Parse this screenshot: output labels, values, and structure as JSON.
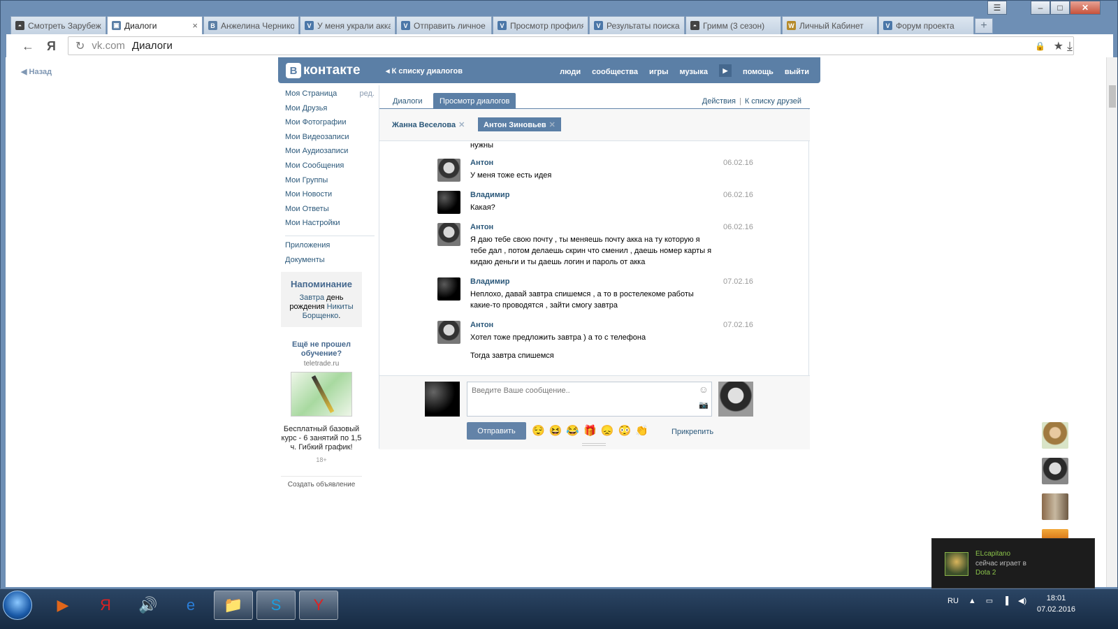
{
  "window": {
    "controls": [
      "☰",
      "–",
      "□",
      "✕"
    ]
  },
  "tabs": [
    {
      "label": "Смотреть Зарубежные",
      "icon": "ghost-icon",
      "color": "#444",
      "glyph": "◓"
    },
    {
      "label": "Диалоги",
      "icon": "vk-icon",
      "color": "#5b7fa6",
      "glyph": "▣",
      "active": true,
      "close": "×"
    },
    {
      "label": "Анжелина Черникова",
      "icon": "vk-icon",
      "color": "#5b7fa6",
      "glyph": "B"
    },
    {
      "label": "У меня украли аккаунт",
      "icon": "forum-icon",
      "color": "#4b77a8",
      "glyph": "V"
    },
    {
      "label": "Отправить личное",
      "icon": "forum-icon",
      "color": "#4b77a8",
      "glyph": "V"
    },
    {
      "label": "Просмотр профиля",
      "icon": "forum-icon",
      "color": "#4b77a8",
      "glyph": "V"
    },
    {
      "label": "Результаты поиска",
      "icon": "forum-icon",
      "color": "#4b77a8",
      "glyph": "V"
    },
    {
      "label": "Гримм (3 сезон)",
      "icon": "ghost-icon",
      "color": "#444",
      "glyph": "◓"
    },
    {
      "label": "Личный Кабинет",
      "icon": "wow-icon",
      "color": "#b58a2a",
      "glyph": "W"
    },
    {
      "label": "Форум проекта",
      "icon": "forum-icon",
      "color": "#4b77a8",
      "glyph": "V"
    }
  ],
  "toolbar": {
    "back": "←",
    "yandex": "Я",
    "reload": "↻",
    "host": "vk.com",
    "title": "Диалоги",
    "lock": "🔒",
    "star": "★",
    "download": "⤓"
  },
  "page": {
    "back_link": "Назад",
    "header": {
      "logo_b": "B",
      "logo_text": "контакте",
      "back_to_list": "К списку диалогов",
      "nav": [
        "люди",
        "сообщества",
        "игры",
        "музыка",
        "помощь",
        "выйти"
      ]
    },
    "left_menu": [
      {
        "label": "Моя Страница",
        "edit": "ред."
      },
      {
        "label": "Мои Друзья"
      },
      {
        "label": "Мои Фотографии"
      },
      {
        "label": "Мои Видеозаписи"
      },
      {
        "label": "Мои Аудиозаписи"
      },
      {
        "label": "Мои Сообщения"
      },
      {
        "label": "Мои Группы"
      },
      {
        "label": "Мои Новости"
      },
      {
        "label": "Мои Ответы"
      },
      {
        "label": "Мои Настройки"
      }
    ],
    "left_menu_extra": [
      "Приложения",
      "Документы"
    ],
    "reminder": {
      "title": "Напоминание",
      "w1": "Завтра",
      "w2": "день рождения",
      "w3": "Никиты Борщенко",
      "w4": "."
    },
    "ad": {
      "title": "Ещё не прошел обучение?",
      "domain": "teletrade.ru",
      "desc": "Бесплатный базовый курс - 6 занятий по 1,5 ч. Гибкий график!",
      "age": "18+",
      "create": "Создать объявление"
    },
    "subtabs": {
      "dialogs": "Диалоги",
      "view": "Просмотр диалогов",
      "actions": "Действия",
      "sep": "|",
      "friends": "К списку друзей"
    },
    "peers": [
      {
        "name": "Жанна Веселова",
        "x": "✕"
      },
      {
        "name": "Антон Зиновьев",
        "x": "✕",
        "active": true
      }
    ],
    "partial_text": "нужны",
    "messages": [
      {
        "author": "Антон",
        "date": "06.02.16",
        "text": "У меня тоже есть идея",
        "who": "anton"
      },
      {
        "author": "Владимир",
        "date": "06.02.16",
        "text": "Какая?",
        "who": "vlad"
      },
      {
        "author": "Антон",
        "date": "06.02.16",
        "text": "Я даю тебе свою почту , ты меняешь почту акка на ту которую я тебе дал , потом делаешь скрин что сменил , даешь номер карты я кидаю деньги и ты даешь логин и пароль от акка",
        "who": "anton"
      },
      {
        "author": "Владимир",
        "date": "07.02.16",
        "text": "Неплохо, давай завтра спишемся , а то в ростелекоме работы какие-то проводятся , зайти смогу завтра",
        "who": "vlad"
      },
      {
        "author": "Антон",
        "date": "07.02.16",
        "text": "Хотел тоже предложить завтра ) а то с телефона",
        "text2": "Тогда завтра спишемся",
        "who": "anton"
      }
    ],
    "compose": {
      "placeholder": "Введите Ваше сообщение..",
      "smile": "☺",
      "camera": "📷",
      "send": "Отправить",
      "attach": "Прикрепить",
      "emojis": [
        "😌",
        "😆",
        "😂",
        "🎁",
        "😞",
        "😳",
        "👏"
      ]
    }
  },
  "notification": {
    "user": "ELcapitano",
    "line2": "сейчас играет в",
    "game": "Dota 2"
  },
  "taskbar": {
    "lang": "RU",
    "time": "18:01",
    "date": "07.02.2016",
    "apps": [
      "▶",
      "Я",
      "🔊",
      "e",
      "📁",
      "S",
      "Y"
    ]
  }
}
